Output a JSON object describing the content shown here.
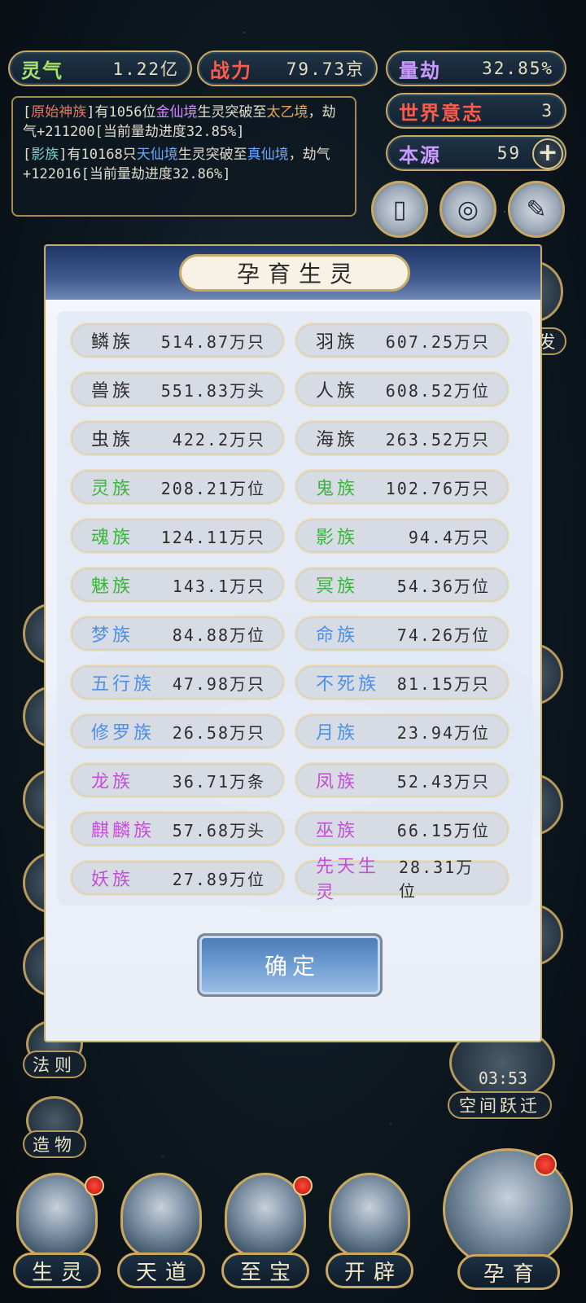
{
  "stats": {
    "lingqi": {
      "label": "灵气",
      "value": "1.22亿"
    },
    "zhanli": {
      "label": "战力",
      "value": "79.73京"
    },
    "liangjie": {
      "label": "量劫",
      "value": "32.85%"
    },
    "shijie": {
      "label": "世界意志",
      "value": "3"
    },
    "benyuan": {
      "label": "本源",
      "value": "59",
      "plus": "+"
    }
  },
  "log": [
    {
      "bracket_open": "[",
      "race": "原始神族",
      "bracket_close": "]",
      "t1": "有1056位",
      "realm": "金仙境",
      "t2": "生灵突破至",
      "target": "太乙境",
      "t3": "，劫气+211200[当前量劫进度32.85%]"
    },
    {
      "bracket_open": "[",
      "race": "影族",
      "bracket_close": "]",
      "t1": "有10168只",
      "realm": "天仙境",
      "t2": "生灵突破至",
      "target": "真仙境",
      "t3": "，劫气+122016[当前量劫进度32.86%]"
    }
  ],
  "side_left": [
    "法则",
    "造物"
  ],
  "side_right": {
    "timer": "03:53",
    "label": "空间跃迁"
  },
  "side_partial": {
    "right_top": "发"
  },
  "nav": [
    "生灵",
    "天道",
    "至宝",
    "开辟",
    "孕育"
  ],
  "modal": {
    "title": "孕育生灵",
    "confirm": "确定",
    "rows": [
      {
        "left": {
          "name": "鳞族",
          "count": "514.87万只",
          "color": "#2d2d2d"
        },
        "right": {
          "name": "羽族",
          "count": "607.25万只",
          "color": "#2d2d2d"
        }
      },
      {
        "left": {
          "name": "兽族",
          "count": "551.83万头",
          "color": "#2d2d2d"
        },
        "right": {
          "name": "人族",
          "count": "608.52万位",
          "color": "#2d2d2d"
        }
      },
      {
        "left": {
          "name": "虫族",
          "count": "422.2万只",
          "color": "#2d2d2d"
        },
        "right": {
          "name": "海族",
          "count": "263.52万只",
          "color": "#2d2d2d"
        }
      },
      {
        "left": {
          "name": "灵族",
          "count": "208.21万位",
          "color": "#37b83a"
        },
        "right": {
          "name": "鬼族",
          "count": "102.76万只",
          "color": "#37b83a"
        }
      },
      {
        "left": {
          "name": "魂族",
          "count": "124.11万只",
          "color": "#37b83a"
        },
        "right": {
          "name": "影族",
          "count": "94.4万只",
          "color": "#37b83a"
        }
      },
      {
        "left": {
          "name": "魅族",
          "count": "143.1万只",
          "color": "#37b83a"
        },
        "right": {
          "name": "冥族",
          "count": "54.36万位",
          "color": "#37b83a"
        }
      },
      {
        "left": {
          "name": "梦族",
          "count": "84.88万位",
          "color": "#4c8fe6"
        },
        "right": {
          "name": "命族",
          "count": "74.26万位",
          "color": "#4c8fe6"
        }
      },
      {
        "left": {
          "name": "五行族",
          "count": "47.98万只",
          "color": "#4c8fe6"
        },
        "right": {
          "name": "不死族",
          "count": "81.15万只",
          "color": "#4c8fe6"
        }
      },
      {
        "left": {
          "name": "修罗族",
          "count": "26.58万只",
          "color": "#4c8fe6"
        },
        "right": {
          "name": "月族",
          "count": "23.94万位",
          "color": "#4c8fe6"
        }
      },
      {
        "left": {
          "name": "龙族",
          "count": "36.71万条",
          "color": "#c34fd6"
        },
        "right": {
          "name": "凤族",
          "count": "52.43万只",
          "color": "#c34fd6"
        }
      },
      {
        "left": {
          "name": "麒麟族",
          "count": "57.68万头",
          "color": "#c34fd6"
        },
        "right": {
          "name": "巫族",
          "count": "66.15万位",
          "color": "#c34fd6"
        }
      },
      {
        "left": {
          "name": "妖族",
          "count": "27.89万位",
          "color": "#c34fd6"
        },
        "right": {
          "name": "先天生灵",
          "count": "28.31万位",
          "color": "#c34fd6"
        }
      }
    ]
  },
  "icons": {
    "top_ring_1": "card-icon",
    "top_ring_2": "swirl-icon",
    "top_ring_3": "scroll-icon"
  }
}
